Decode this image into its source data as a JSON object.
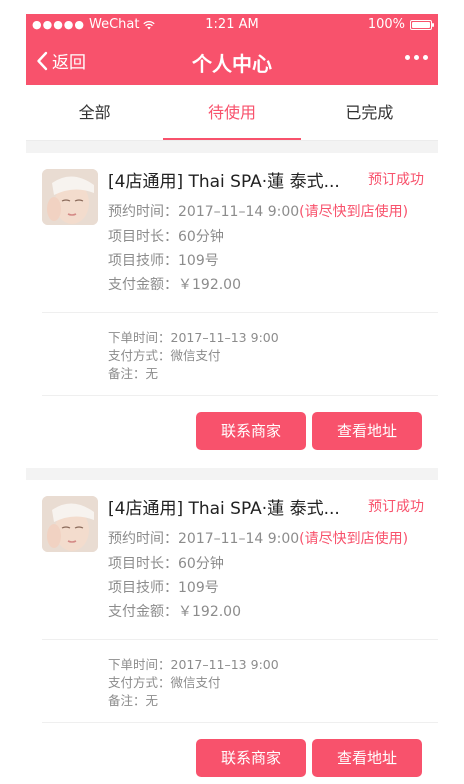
{
  "status_bar": {
    "dots": "●●●●●",
    "carrier": "WeChat",
    "time": "1:21 AM",
    "battery": "100%"
  },
  "nav": {
    "back_label": "返回",
    "title": "个人中心"
  },
  "tabs": [
    {
      "label": "全部",
      "active": false
    },
    {
      "label": "待使用",
      "active": true
    },
    {
      "label": "已完成",
      "active": false
    }
  ],
  "orders": [
    {
      "title": "[4店通用] Thai SPA·蓮 泰式...",
      "status": "预订成功",
      "appointment_label": "预约时间：",
      "appointment_time": "2017–11–14 9:00",
      "appointment_note": "(请尽快到店使用)",
      "duration_label": "项目时长：",
      "duration": "60分钟",
      "technician_label": "项目技师：",
      "technician": "109号",
      "amount_label": "支付金额：",
      "amount": "￥192.00",
      "order_time_label": "下单时间：",
      "order_time": "2017–11–13 9:00",
      "payment_label": "支付方式：",
      "payment": "微信支付",
      "remark_label": "备注：",
      "remark": "无",
      "contact_btn": "联系商家",
      "address_btn": "查看地址"
    },
    {
      "title": "[4店通用] Thai SPA·蓮 泰式...",
      "status": "预订成功",
      "appointment_label": "预约时间：",
      "appointment_time": "2017–11–14 9:00",
      "appointment_note": "(请尽快到店使用)",
      "duration_label": "项目时长：",
      "duration": "60分钟",
      "technician_label": "项目技师：",
      "technician": "109号",
      "amount_label": "支付金额：",
      "amount": "￥192.00",
      "order_time_label": "下单时间：",
      "order_time": "2017–11–13 9:00",
      "payment_label": "支付方式：",
      "payment": "微信支付",
      "remark_label": "备注：",
      "remark": "无",
      "contact_btn": "联系商家",
      "address_btn": "查看地址"
    }
  ],
  "colors": {
    "accent": "#f8526c",
    "text_muted": "#8c8c8c",
    "text_main": "#222222",
    "gap_bg": "#f3f3f3"
  }
}
